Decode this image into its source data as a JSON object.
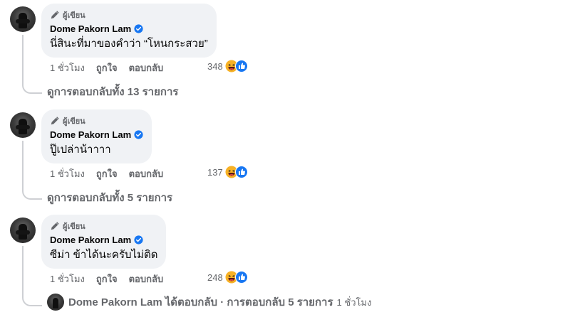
{
  "comments": [
    {
      "author_badge": "ผู้เขียน",
      "author": "Dome Pakorn Lam",
      "text": "นี่สินะที่มาของคำว่า “โหนกระสวย”",
      "time": "1 ชั่วโมง",
      "like_label": "ถูกใจ",
      "reply_label": "ตอบกลับ",
      "reaction_count": "348",
      "view_replies": "ดูการตอบกลับทั้ง 13 รายการ"
    },
    {
      "author_badge": "ผู้เขียน",
      "author": "Dome Pakorn Lam",
      "text": "ปู๊เปล่าน้าาาา",
      "time": "1 ชั่วโมง",
      "like_label": "ถูกใจ",
      "reply_label": "ตอบกลับ",
      "reaction_count": "137",
      "view_replies": "ดูการตอบกลับทั้ง 5 รายการ"
    },
    {
      "author_badge": "ผู้เขียน",
      "author": "Dome Pakorn Lam",
      "text": "ซีม่า ข้าได้นะครับไม่ติด",
      "time": "1 ชั่วโมง",
      "like_label": "ถูกใจ",
      "reply_label": "ตอบกลับ",
      "reaction_count": "248"
    }
  ],
  "reply_summary": {
    "name": "Dome Pakorn Lam",
    "text": "ได้ตอบกลับ · การตอบกลับ 5 รายการ",
    "time": "1 ชั่วโมง"
  },
  "icons": {
    "author_badge": "pencil-icon",
    "verified": "verified-badge-icon",
    "reaction_1": "haha-reaction-icon",
    "reaction_2": "like-reaction-icon"
  },
  "colors": {
    "bubble_bg": "#f0f2f5",
    "secondary_text": "#65676b",
    "verified_blue": "#1877f2",
    "haha_yellow": "#f7b125",
    "thread_line": "#ced0d4"
  }
}
